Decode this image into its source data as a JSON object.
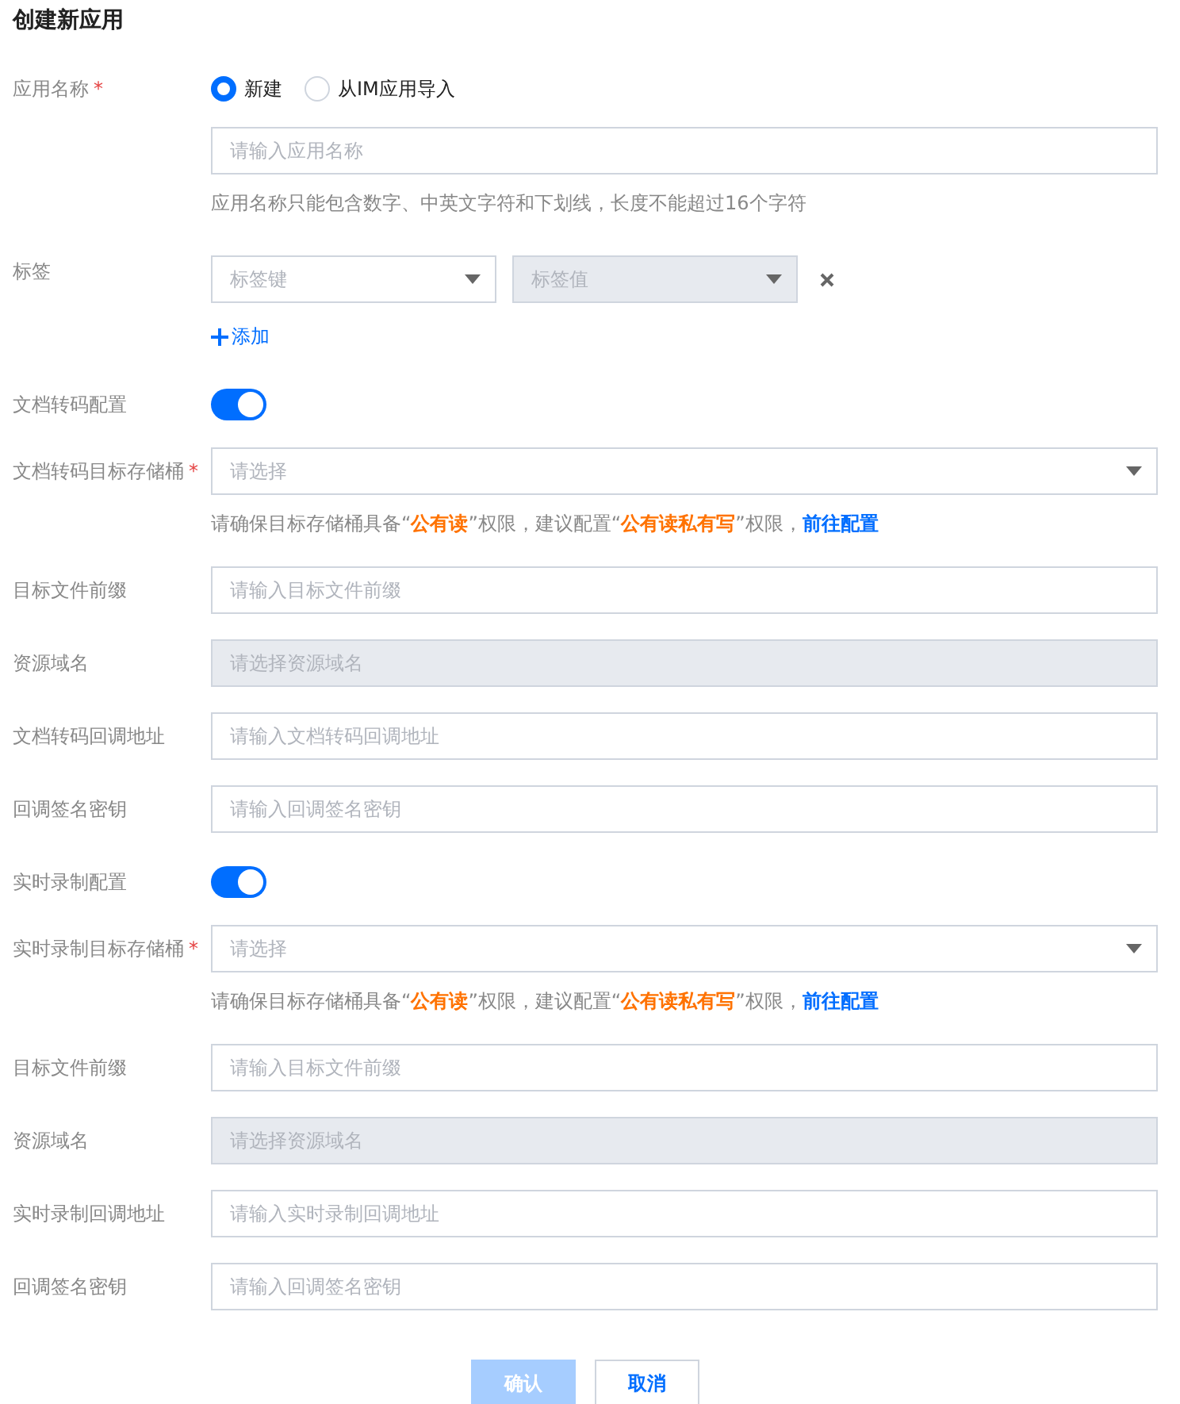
{
  "dialog": {
    "title": "创建新应用"
  },
  "items": [
    {
      "kind": "name",
      "label": "应用名称",
      "required_mark": "*",
      "options": [
        {
          "label": "新建",
          "selected": true
        },
        {
          "label": "从IM应用导入",
          "selected": false
        }
      ],
      "placeholder": "请输入应用名称",
      "help": "应用名称只能包含数字、中英文字符和下划线，长度不能超过16个字符"
    },
    {
      "kind": "tags",
      "label": "标签",
      "key_placeholder": "标签键",
      "value_placeholder": "标签值",
      "value_disabled": true,
      "add_label": "添加"
    },
    {
      "kind": "toggle",
      "label": "文档转码配置",
      "on": true
    },
    {
      "kind": "select",
      "label": "文档转码目标存储桶",
      "required_mark": "*",
      "placeholder": "请选择",
      "hint": [
        {
          "text": "请确保目标存储桶具备“"
        },
        {
          "text": "公有读",
          "kind": "emphasis"
        },
        {
          "text": "”权限，建议配置“"
        },
        {
          "text": "公有读私有写",
          "kind": "emphasis"
        },
        {
          "text": "”权限，"
        }
      ],
      "link": "前往配置"
    },
    {
      "kind": "input",
      "label": "目标文件前缀",
      "placeholder": "请输入目标文件前缀",
      "disabled": false
    },
    {
      "kind": "input",
      "label": "资源域名",
      "placeholder": "请选择资源域名",
      "disabled": true
    },
    {
      "kind": "input",
      "label": "文档转码回调地址",
      "placeholder": "请输入文档转码回调地址",
      "disabled": false
    },
    {
      "kind": "input",
      "label": "回调签名密钥",
      "placeholder": "请输入回调签名密钥",
      "disabled": false
    },
    {
      "kind": "toggle",
      "label": "实时录制配置",
      "on": true
    },
    {
      "kind": "select",
      "label": "实时录制目标存储桶",
      "required_mark": "*",
      "placeholder": "请选择",
      "hint": [
        {
          "text": "请确保目标存储桶具备“"
        },
        {
          "text": "公有读",
          "kind": "emphasis"
        },
        {
          "text": "”权限，建议配置“"
        },
        {
          "text": "公有读私有写",
          "kind": "emphasis"
        },
        {
          "text": "”权限，"
        }
      ],
      "link": "前往配置"
    },
    {
      "kind": "input",
      "label": "目标文件前缀",
      "placeholder": "请输入目标文件前缀",
      "disabled": false
    },
    {
      "kind": "input",
      "label": "资源域名",
      "placeholder": "请选择资源域名",
      "disabled": true
    },
    {
      "kind": "input",
      "label": "实时录制回调地址",
      "placeholder": "请输入实时录制回调地址",
      "disabled": false
    },
    {
      "kind": "input",
      "label": "回调签名密钥",
      "placeholder": "请输入回调签名密钥",
      "disabled": false
    }
  ],
  "buttons": [
    {
      "label": "确认",
      "kind": "primary",
      "disabled": true
    },
    {
      "label": "取消",
      "kind": "secondary",
      "disabled": false
    }
  ]
}
